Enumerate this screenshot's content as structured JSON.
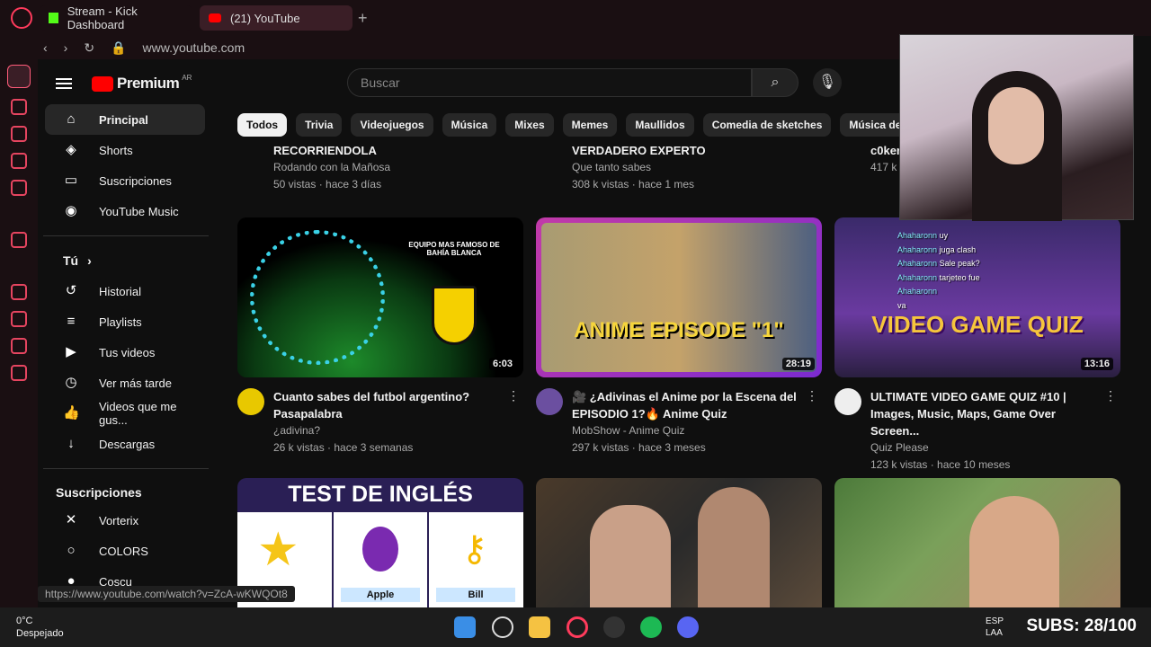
{
  "browser": {
    "tabs": [
      {
        "label": "Stream - Kick Dashboard"
      },
      {
        "label": "(21) YouTube"
      }
    ],
    "url": "www.youtube.com",
    "status_url": "https://www.youtube.com/watch?v=ZcA-wKWQOt8"
  },
  "youtube": {
    "logo_text": "Premium",
    "region": "AR",
    "search_placeholder": "Buscar",
    "sidebar": {
      "main": [
        {
          "label": "Principal",
          "icon": "home-icon"
        },
        {
          "label": "Shorts",
          "icon": "shorts-icon"
        },
        {
          "label": "Suscripciones",
          "icon": "subscriptions-icon"
        },
        {
          "label": "YouTube Music",
          "icon": "music-icon"
        }
      ],
      "you_title": "Tú",
      "you": [
        {
          "label": "Historial",
          "icon": "history-icon"
        },
        {
          "label": "Playlists",
          "icon": "playlist-icon"
        },
        {
          "label": "Tus videos",
          "icon": "video-icon"
        },
        {
          "label": "Ver más tarde",
          "icon": "clock-icon"
        },
        {
          "label": "Videos que me gus...",
          "icon": "like-icon"
        },
        {
          "label": "Descargas",
          "icon": "download-icon"
        }
      ],
      "subs_title": "Suscripciones",
      "subs": [
        {
          "label": "Vorterix",
          "icon": "vorterix-icon"
        },
        {
          "label": "COLORS",
          "icon": "colors-icon"
        },
        {
          "label": "Coscu",
          "icon": "coscu-icon"
        }
      ]
    },
    "chips": [
      "Todos",
      "Trivia",
      "Videojuegos",
      "Música",
      "Mixes",
      "Memes",
      "Maullidos",
      "Comedia de sketches",
      "Música de med"
    ],
    "prev_row": [
      {
        "title": "RECORRIENDOLA",
        "channel": "Rodando con la Mañosa",
        "meta": "50 vistas · hace 3 días"
      },
      {
        "title": "VERDADERO EXPERTO",
        "channel": "Que tanto sabes",
        "meta": "308 k vistas · hace 1 mes"
      },
      {
        "title": "c0ker",
        "channel": "417 k",
        "meta": ""
      }
    ],
    "videos": [
      {
        "title": "Cuanto sabes del futbol argentino? Pasapalabra",
        "channel": "¿adivina?",
        "meta": "26 k vistas · hace 3 semanas",
        "duration": "6:03",
        "thumb_text": "EQUIPO MAS FAMOSO DE BAHÍA BLANCA"
      },
      {
        "title": "🎥 ¿Adivinas el Anime por la Escena del EPISODIO 1?🔥 Anime Quiz",
        "channel": "MobShow - Anime Quiz",
        "meta": "297 k vistas · hace 3 meses",
        "duration": "28:19",
        "thumb_text": "ANIME EPISODE \"1\""
      },
      {
        "title": "ULTIMATE VIDEO GAME QUIZ #10 | Images, Music, Maps, Game Over Screen...",
        "channel": "Quiz Please",
        "meta": "123 k vistas · hace 10 meses",
        "duration": "13:16",
        "thumb_text": "VIDEO GAME QUIZ"
      }
    ],
    "next_row": [
      {
        "thumb_text": "TEST DE INGLÉS",
        "opt_a1": "Apple",
        "opt_a2": "Bill"
      },
      {
        "thumb_text": ""
      },
      {
        "thumb_text": ""
      }
    ]
  },
  "chat": [
    {
      "user": "Ahaharonn",
      "msg": "uy"
    },
    {
      "user": "Ahaharonn",
      "msg": "juga clash"
    },
    {
      "user": "Ahaharonn",
      "msg": "Sale peak?"
    },
    {
      "user": "Ahaharonn",
      "msg": "tarjeteo fue"
    },
    {
      "user": "Ahaharonn",
      "msg": ""
    },
    {
      "user": "",
      "msg": "va"
    }
  ],
  "taskbar": {
    "temp": "0°C",
    "weather": "Despejado",
    "lang": "ESP",
    "lang2": "LAA",
    "subs": "SUBS: 28/100"
  }
}
